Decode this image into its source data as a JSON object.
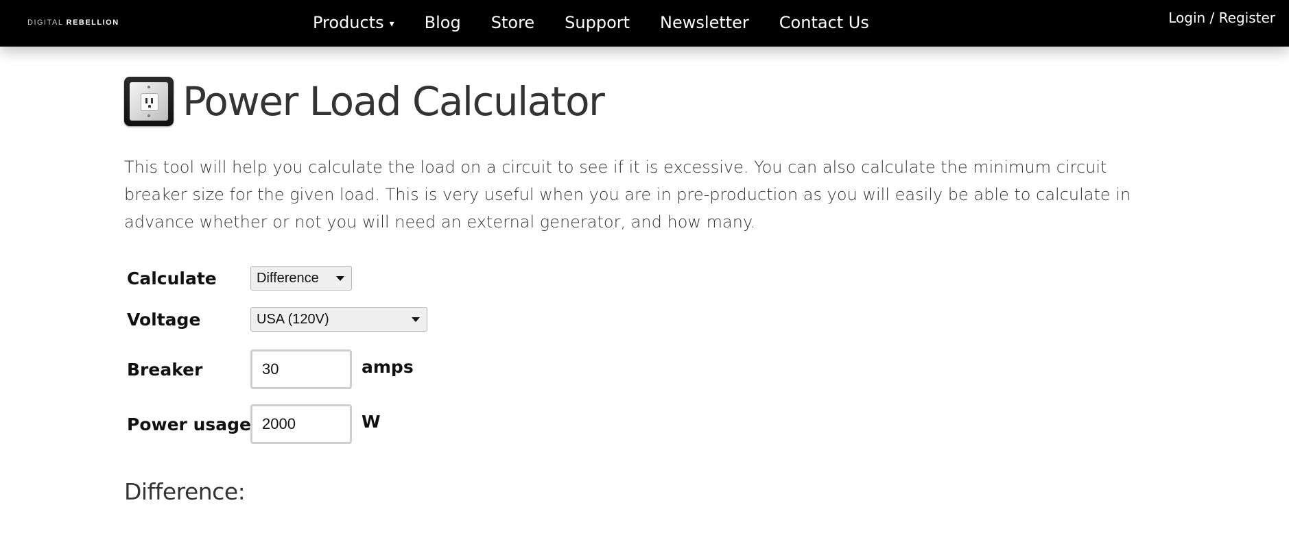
{
  "nav": {
    "logo_light": "DIGITAL",
    "logo_bold": "REBELLION",
    "items": [
      {
        "label": "Products",
        "caret": "▾"
      },
      {
        "label": "Blog"
      },
      {
        "label": "Store"
      },
      {
        "label": "Support"
      },
      {
        "label": "Newsletter"
      },
      {
        "label": "Contact Us"
      }
    ],
    "login": "Login / Register"
  },
  "page": {
    "title": "Power Load Calculator",
    "icon": "power-outlet-icon",
    "intro": "This tool will help you calculate the load on a circuit to see if it is excessive. You can also calculate the minimum circuit breaker size for the given load. This is very useful when you are in pre-production as you will easily be able to calculate in advance whether or not you will need an external generator, and how many."
  },
  "form": {
    "calculate": {
      "label": "Calculate",
      "value": "Difference"
    },
    "voltage": {
      "label": "Voltage",
      "value": "USA (120V)"
    },
    "breaker": {
      "label": "Breaker",
      "value": "30",
      "unit": "amps"
    },
    "power": {
      "label": "Power usage",
      "value": "2000",
      "unit": "W"
    }
  },
  "result": {
    "label": "Difference:"
  },
  "colors": {
    "nav_bg": "#000000",
    "text": "#333333"
  }
}
